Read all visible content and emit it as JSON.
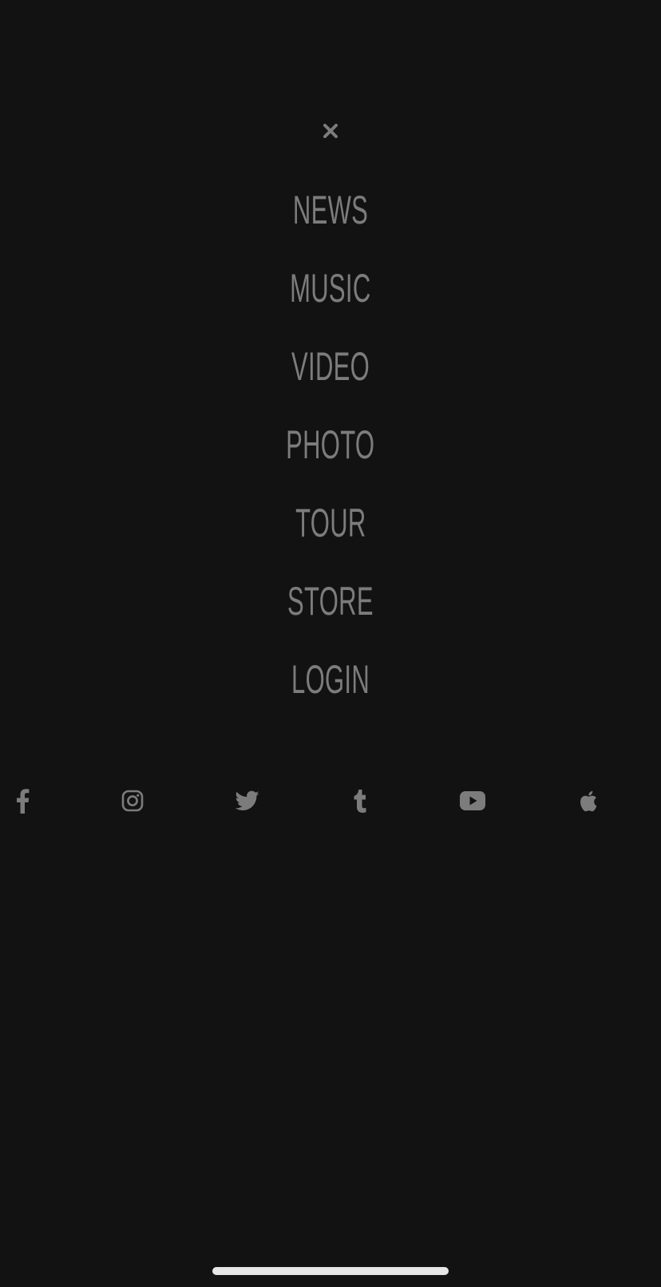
{
  "menu": {
    "close_icon": "close-icon",
    "items": [
      {
        "label": "NEWS"
      },
      {
        "label": "MUSIC"
      },
      {
        "label": "VIDEO"
      },
      {
        "label": "PHOTO"
      },
      {
        "label": "TOUR"
      },
      {
        "label": "STORE"
      },
      {
        "label": "LOGIN"
      }
    ]
  },
  "social": [
    {
      "icon": "facebook-icon"
    },
    {
      "icon": "instagram-icon"
    },
    {
      "icon": "twitter-icon"
    },
    {
      "icon": "tumblr-icon"
    },
    {
      "icon": "youtube-icon"
    },
    {
      "icon": "apple-icon"
    }
  ],
  "colors": {
    "background": "#121212",
    "text": "#7c7c7c",
    "home_indicator": "#e6e6e6"
  }
}
